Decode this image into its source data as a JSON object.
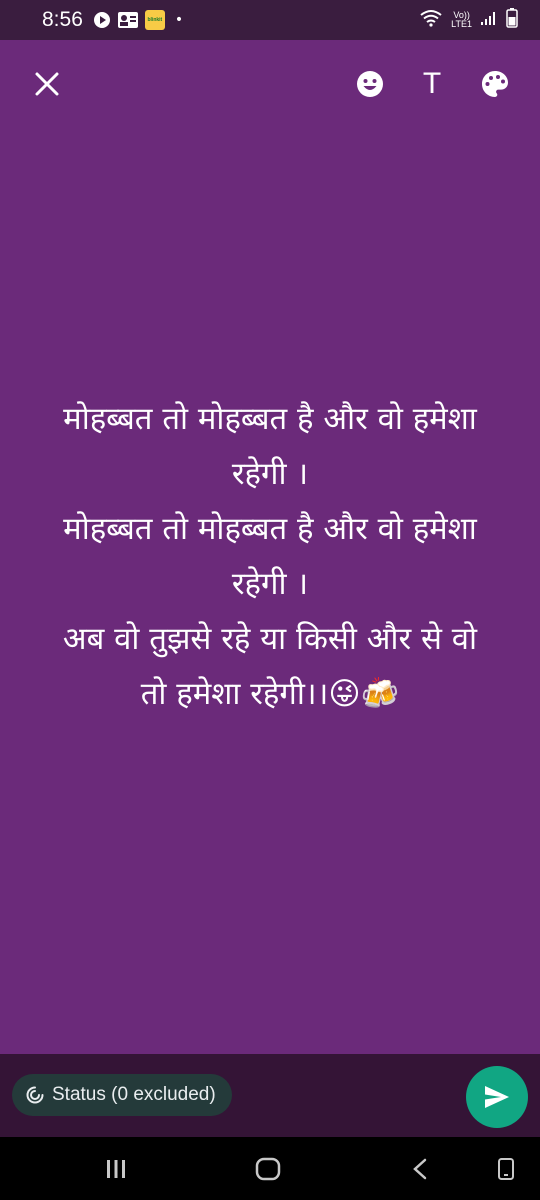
{
  "status_bar": {
    "time": "8:56",
    "notification_icons": [
      "play-icon",
      "contact-card-icon",
      "blinkit-icon"
    ],
    "blinkit_label": "blinkit",
    "dot": "•",
    "network_label_top": "Vo))",
    "network_label_bottom": "LTE1"
  },
  "toolbar": {
    "close_icon": "close-icon",
    "emoji_icon": "emoji-icon",
    "text_icon": "T",
    "palette_icon": "palette-icon"
  },
  "canvas": {
    "background_color": "#6b2a7a",
    "text": "मोहब्बत तो मोहब्बत है और वो हमेशा\nरहेगी ।\nमोहब्बत तो मोहब्बत है और वो हमेशा\nरहेगी ।\nअब वो तुझसे रहे या किसी और से वो\nतो हमेशा रहेगी।।😜🍻"
  },
  "bottom": {
    "audience_label": "Status (0 excluded)",
    "send_color": "#11a683"
  },
  "nav": {
    "recents_icon": "recents-icon",
    "home_icon": "home-icon",
    "back_icon": "back-icon",
    "accessibility_icon": "screenshot-icon"
  }
}
